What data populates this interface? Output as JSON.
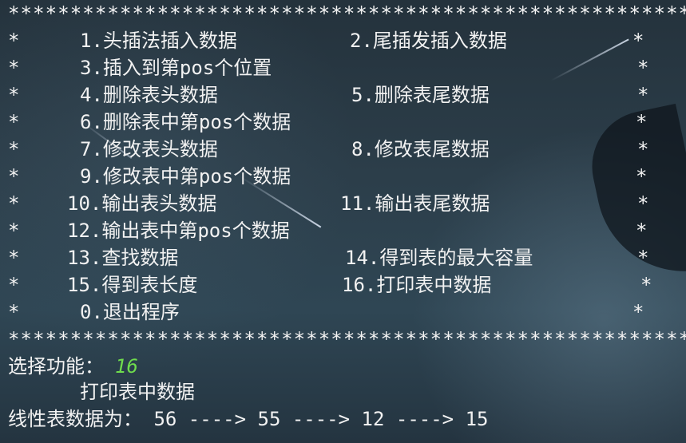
{
  "border_text": "*****************************************************************",
  "menu": [
    {
      "left_star": "*",
      "opt1": "1.头插法插入数据",
      "opt2": "2.尾插发插入数据",
      "right_star": "*"
    },
    {
      "left_star": "*",
      "opt1": "3.插入到第pos个位置",
      "opt2": "",
      "right_star": "*"
    },
    {
      "left_star": "*",
      "opt1": "4.删除表头数据",
      "opt2": "5.删除表尾数据",
      "right_star": "*"
    },
    {
      "left_star": "*",
      "opt1": "6.删除表中第pos个数据",
      "opt2": "",
      "right_star": "*"
    },
    {
      "left_star": "*",
      "opt1": "7.修改表头数据",
      "opt2": "8.修改表尾数据",
      "right_star": "*"
    },
    {
      "left_star": "*",
      "opt1": "9.修改表中第pos个数据",
      "opt2": "",
      "right_star": "*"
    },
    {
      "left_star": "*",
      "opt1": "10.输出表头数据",
      "opt2": "11.输出表尾数据",
      "right_star": "*"
    },
    {
      "left_star": "*",
      "opt1": "12.输出表中第pos个数据",
      "opt2": "",
      "right_star": "*"
    },
    {
      "left_star": "*",
      "opt1": "13.查找数据",
      "opt2": "14.得到表的最大容量",
      "right_star": "*"
    },
    {
      "left_star": "*",
      "opt1": "15.得到表长度",
      "opt2": "16.打印表中数据",
      "right_star": "*"
    },
    {
      "left_star": "*",
      "opt1": "0.退出程序",
      "opt2": "",
      "right_star": "*"
    }
  ],
  "prompt": {
    "label": "选择功能：",
    "input_value": "16"
  },
  "echo_text": "打印表中数据",
  "result_text": "线性表数据为： 56 ----> 55 ----> 12 ----> 15",
  "colors": {
    "text": "#f2f2f2",
    "input": "#6fdc4d"
  }
}
